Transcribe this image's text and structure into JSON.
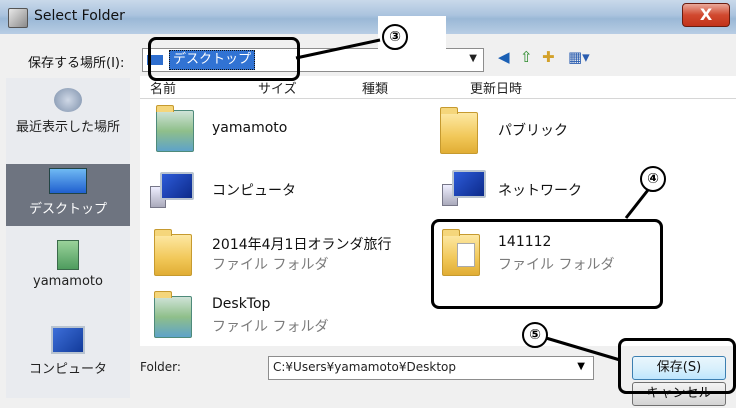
{
  "window": {
    "title": "Select Folder",
    "close_glyph": "X"
  },
  "save_in": {
    "label": "保存する場所(I):",
    "value": "デスクトップ"
  },
  "columns": [
    "名前",
    "サイズ",
    "種類",
    "更新日時"
  ],
  "places": [
    {
      "label": "最近表示した場所",
      "icon": "recent-places-icon"
    },
    {
      "label": "デスクトップ",
      "icon": "desktop-icon",
      "selected": true
    },
    {
      "label": "yamamoto",
      "icon": "user-folder-icon"
    },
    {
      "label": "コンピュータ",
      "icon": "computer-icon"
    }
  ],
  "items": [
    {
      "name": "yamamoto",
      "type": "",
      "icon": "user-folder-icon"
    },
    {
      "name": "パブリック",
      "type": "",
      "icon": "folder-icon"
    },
    {
      "name": "コンピュータ",
      "type": "",
      "icon": "computer-icon"
    },
    {
      "name": "ネットワーク",
      "type": "",
      "icon": "network-icon"
    },
    {
      "name": "2014年4月1日オランダ旅行",
      "type": "ファイル フォルダ",
      "icon": "folder-icon"
    },
    {
      "name": "141112",
      "type": "ファイル フォルダ",
      "icon": "folder-icon"
    },
    {
      "name": "DeskTop",
      "type": "ファイル フォルダ",
      "icon": "folder-icon"
    }
  ],
  "folder_field": {
    "label": "Folder:",
    "value": "C:¥Users¥yamamoto¥Desktop"
  },
  "buttons": {
    "save": "保存(S)",
    "cancel": "キャンセル"
  },
  "annotations": {
    "n3": "③",
    "n4": "④",
    "n5": "⑤"
  }
}
